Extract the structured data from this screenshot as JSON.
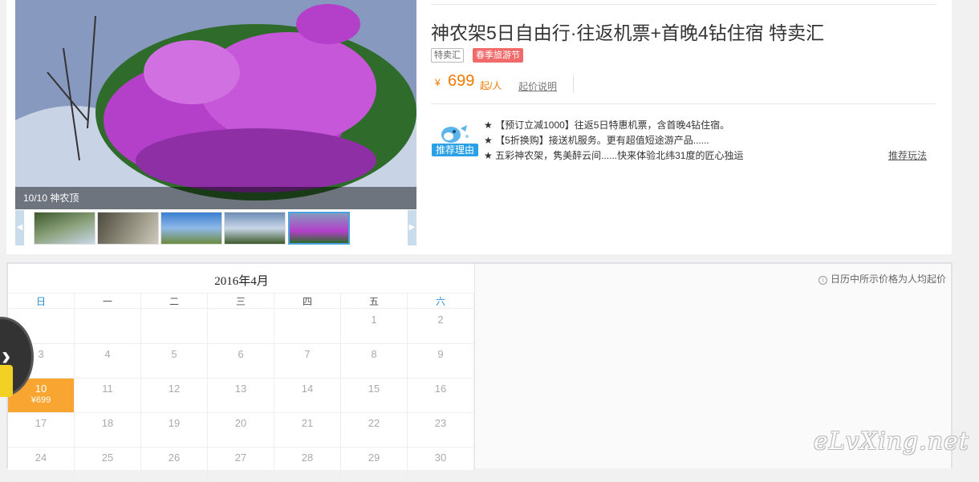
{
  "gallery": {
    "caption": "10/10 神农顶",
    "thumb_count": 5,
    "active_index": 4
  },
  "product": {
    "title": "神农架5日自由行·往返机票+首晚4钻住宿 特卖汇",
    "tag_sale": "特卖汇",
    "tag_festival": "春季旅游节",
    "price_symbol": "¥",
    "price": "699",
    "price_unit": "起/人",
    "price_note_link": "起价说明"
  },
  "recommend": {
    "badge_label": "推荐理由",
    "lines": [
      "★ 【预订立减1000】往返5日特惠机票，含首晚4钻住宿。",
      "★ 【5折换购】接送机服务。更有超值短途游产品......",
      "★ 五彩神农架，隽美醉云间......快来体验北纬31度的匠心独运"
    ],
    "more_link": "推荐玩法"
  },
  "calendar": {
    "title": "2016年4月",
    "note": "日历中所示价格为人均起价",
    "weekdays": [
      "日",
      "一",
      "二",
      "三",
      "四",
      "五",
      "六"
    ],
    "rows": [
      [
        "",
        "",
        "",
        "",
        "",
        "1",
        "2"
      ],
      [
        "3",
        "4",
        "5",
        "6",
        "7",
        "8",
        "9"
      ],
      [
        "10",
        "11",
        "12",
        "13",
        "14",
        "15",
        "16"
      ],
      [
        "17",
        "18",
        "19",
        "20",
        "21",
        "22",
        "23"
      ],
      [
        "24",
        "25",
        "26",
        "27",
        "28",
        "29",
        "30"
      ]
    ],
    "selected_day": "10",
    "selected_price": "¥699"
  },
  "watermark": "eLvXing.net",
  "colors": {
    "price_orange": "#f07a00",
    "selected_cell": "#f8a531",
    "tag_red": "#f06a6a",
    "accent_blue": "#2aa0e6"
  }
}
